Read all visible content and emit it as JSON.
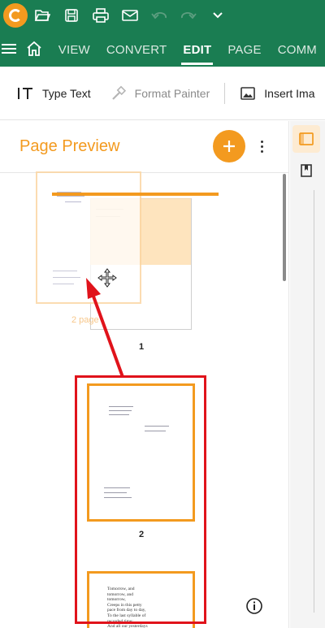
{
  "titlebar": {
    "icons": [
      "app-logo-icon",
      "open-folder-icon",
      "save-icon",
      "print-icon",
      "mail-icon",
      "undo-icon",
      "redo-icon",
      "chevron-down-icon"
    ]
  },
  "menubar": {
    "items": [
      {
        "label": "VIEW",
        "active": false
      },
      {
        "label": "CONVERT",
        "active": false
      },
      {
        "label": "EDIT",
        "active": true
      },
      {
        "label": "PAGE",
        "active": false
      },
      {
        "label": "COMM",
        "active": false
      }
    ]
  },
  "toolbar": {
    "type_text": "Type Text",
    "format_painter": "Format Painter",
    "insert_image": "Insert Ima"
  },
  "panel": {
    "title": "Page Preview"
  },
  "thumbnails": {
    "page1_number": "1",
    "page2_number": "2",
    "ghost_label": "2 page",
    "page3_text": "Tomorrow, and\ntomorrow, and\ntomorrow,\nCreeps in this petty\npace from day to day,\nTo the last syllable of\nrecorded time;\nAnd all our yesterdays"
  },
  "colors": {
    "brand_green": "#1a7d52",
    "accent_orange": "#f39a1f",
    "highlight_red": "#e0131b"
  }
}
